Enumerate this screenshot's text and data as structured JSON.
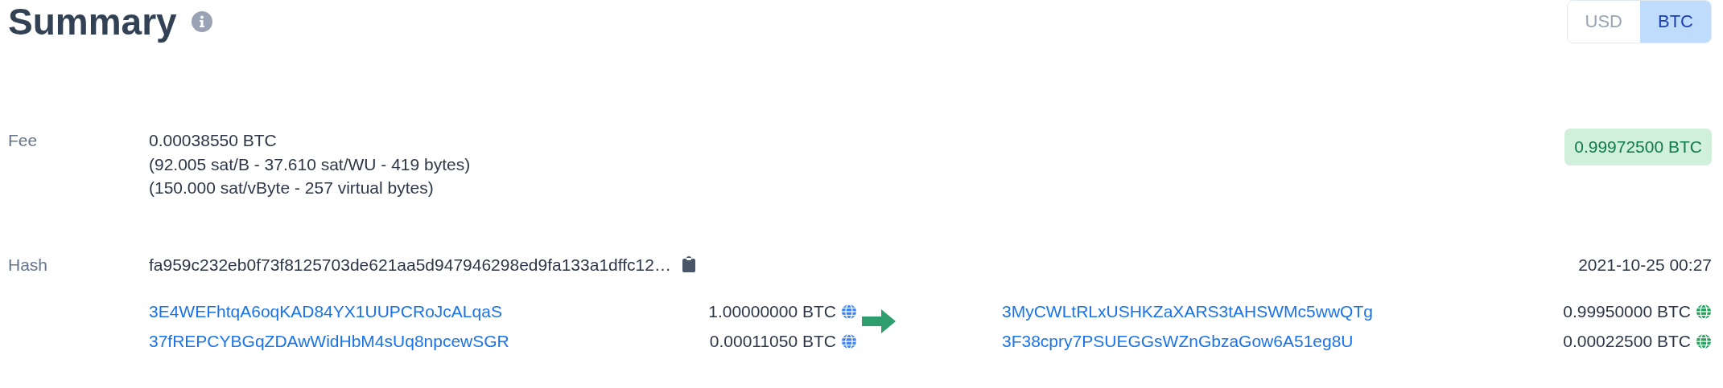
{
  "title": "Summary",
  "currency_toggle": [
    {
      "label": "USD",
      "selected": false
    },
    {
      "label": "BTC",
      "selected": true
    }
  ],
  "fee": {
    "label": "Fee",
    "lines": [
      "0.00038550 BTC",
      "(92.005 sat/B - 37.610 sat/WU - 419 bytes)",
      "(150.000 sat/vByte - 257 virtual bytes)"
    ],
    "total": "0.99972500 BTC"
  },
  "hash": {
    "label": "Hash",
    "value": "fa959c232eb0f73f8125703de621aa5d947946298ed9fa133a1dffc12…",
    "time": "2021-10-25 00:27"
  },
  "inputs": [
    {
      "address": "3E4WEFhtqA6oqKAD84YX1UUPCRoJcALqaS",
      "amount": "1.00000000 BTC",
      "color": "#3b82f6"
    },
    {
      "address": "37fREPCYBGqZDAwWidHbM4sUq8npcewSGR",
      "amount": "0.00011050 BTC",
      "color": "#3b82f6"
    }
  ],
  "outputs": [
    {
      "address": "3MyCWLtRLxUSHKZaXARS3tAHSWMc5wwQTg",
      "amount": "0.99950000 BTC",
      "color": "#22a05a"
    },
    {
      "address": "3F38cpry7PSUEGGsWZnGbzaGow6A51eg8U",
      "amount": "0.00022500 BTC",
      "color": "#22a05a"
    }
  ]
}
